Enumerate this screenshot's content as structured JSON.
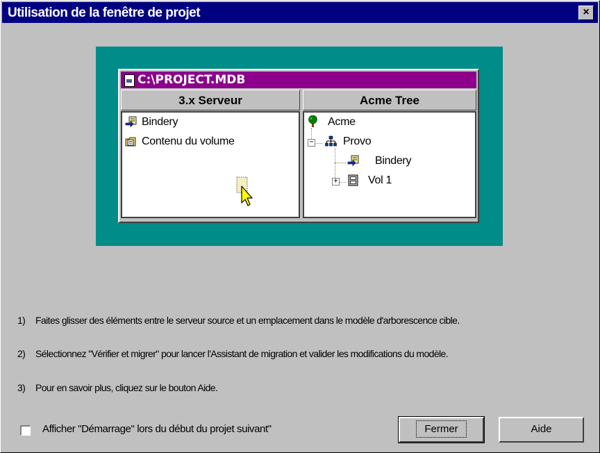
{
  "dialog": {
    "title": "Utilisation de la fenêtre de projet",
    "close_glyph": "×"
  },
  "illustration": {
    "window_title": "C:\\PROJECT.MDB",
    "left_pane": {
      "header": "3.x Serveur",
      "items": [
        {
          "label": "Bindery",
          "icon": "bindery-icon"
        },
        {
          "label": "Contenu du volume",
          "icon": "volume-contents-icon"
        }
      ],
      "drag_icon": "drag-cursor-icon"
    },
    "right_pane": {
      "header": "Acme Tree",
      "items": [
        {
          "label": "Acme",
          "icon": "tree-icon"
        },
        {
          "label": "Provo",
          "icon": "org-unit-icon",
          "expander": "−"
        },
        {
          "label": "Bindery",
          "icon": "bindery-icon"
        },
        {
          "label": "Vol 1",
          "icon": "volume-icon",
          "expander": "+"
        }
      ]
    },
    "colors": {
      "backdrop": "#008c88",
      "window_title": "#8c008c",
      "dialog_title": "#000080"
    }
  },
  "instructions": [
    {
      "num": "1)",
      "text": "Faites glisser des éléments entre le serveur source et un emplacement dans le modèle d'arborescence cible."
    },
    {
      "num": "2)",
      "text": "Sélectionnez \"Vérifier et migrer\" pour lancer l'Assistant de migration et valider les modifications du modèle."
    },
    {
      "num": "3)",
      "text": "Pour en savoir plus, cliquez sur le bouton Aide."
    }
  ],
  "footer": {
    "checkbox_label": "Afficher \"Démarrage\" lors du début du projet suivant\"",
    "checkbox_checked": false,
    "close_button": "Fermer",
    "help_button": "Aide"
  }
}
